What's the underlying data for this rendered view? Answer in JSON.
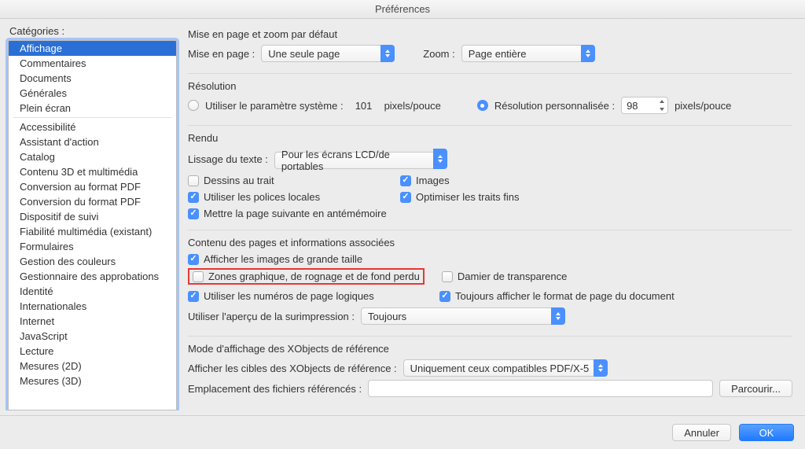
{
  "window_title": "Préférences",
  "sidebar": {
    "label": "Catégories :",
    "group1": [
      "Affichage",
      "Commentaires",
      "Documents",
      "Générales",
      "Plein écran"
    ],
    "group2": [
      "Accessibilité",
      "Assistant d'action",
      "Catalog",
      "Contenu 3D et multimédia",
      "Conversion au format PDF",
      "Conversion du format PDF",
      "Dispositif de suivi",
      "Fiabilité multimédia (existant)",
      "Formulaires",
      "Gestion des couleurs",
      "Gestionnaire des approbations",
      "Identité",
      "Internationales",
      "Internet",
      "JavaScript",
      "Lecture",
      "Mesures (2D)",
      "Mesures (3D)"
    ],
    "selected": "Affichage"
  },
  "layout": {
    "title": "Mise en page et zoom par défaut",
    "page_layout_label": "Mise en page :",
    "page_layout_value": "Une seule page",
    "zoom_label": "Zoom :",
    "zoom_value": "Page entière"
  },
  "resolution": {
    "title": "Résolution",
    "system_label": "Utiliser le paramètre système :",
    "system_value": "101",
    "unit": "pixels/pouce",
    "custom_label": "Résolution personnalisée :",
    "custom_value": "98"
  },
  "rendering": {
    "title": "Rendu",
    "smoothing_label": "Lissage du texte :",
    "smoothing_value": "Pour les écrans LCD/de portables",
    "c1": "Dessins au trait",
    "c2": "Images",
    "c3": "Utiliser les polices locales",
    "c4": "Optimiser les traits fins",
    "c5": "Mettre la page suivante en antémémoire"
  },
  "pagecontent": {
    "title": "Contenu des pages et informations associées",
    "c1": "Afficher les images de grande taille",
    "c2": "Zones graphique, de rognage et de fond perdu",
    "c3": "Damier de transparence",
    "c4": "Utiliser les numéros de page logiques",
    "c5": "Toujours afficher le format de page du document",
    "overprint_label": "Utiliser l'aperçu de la surimpression :",
    "overprint_value": "Toujours"
  },
  "xobjects": {
    "title": "Mode d'affichage des XObjects de référence",
    "targets_label": "Afficher les cibles des XObjects de référence :",
    "targets_value": "Uniquement ceux compatibles PDF/X-5",
    "location_label": "Emplacement des fichiers référencés :",
    "browse": "Parcourir..."
  },
  "footer": {
    "cancel": "Annuler",
    "ok": "OK"
  }
}
